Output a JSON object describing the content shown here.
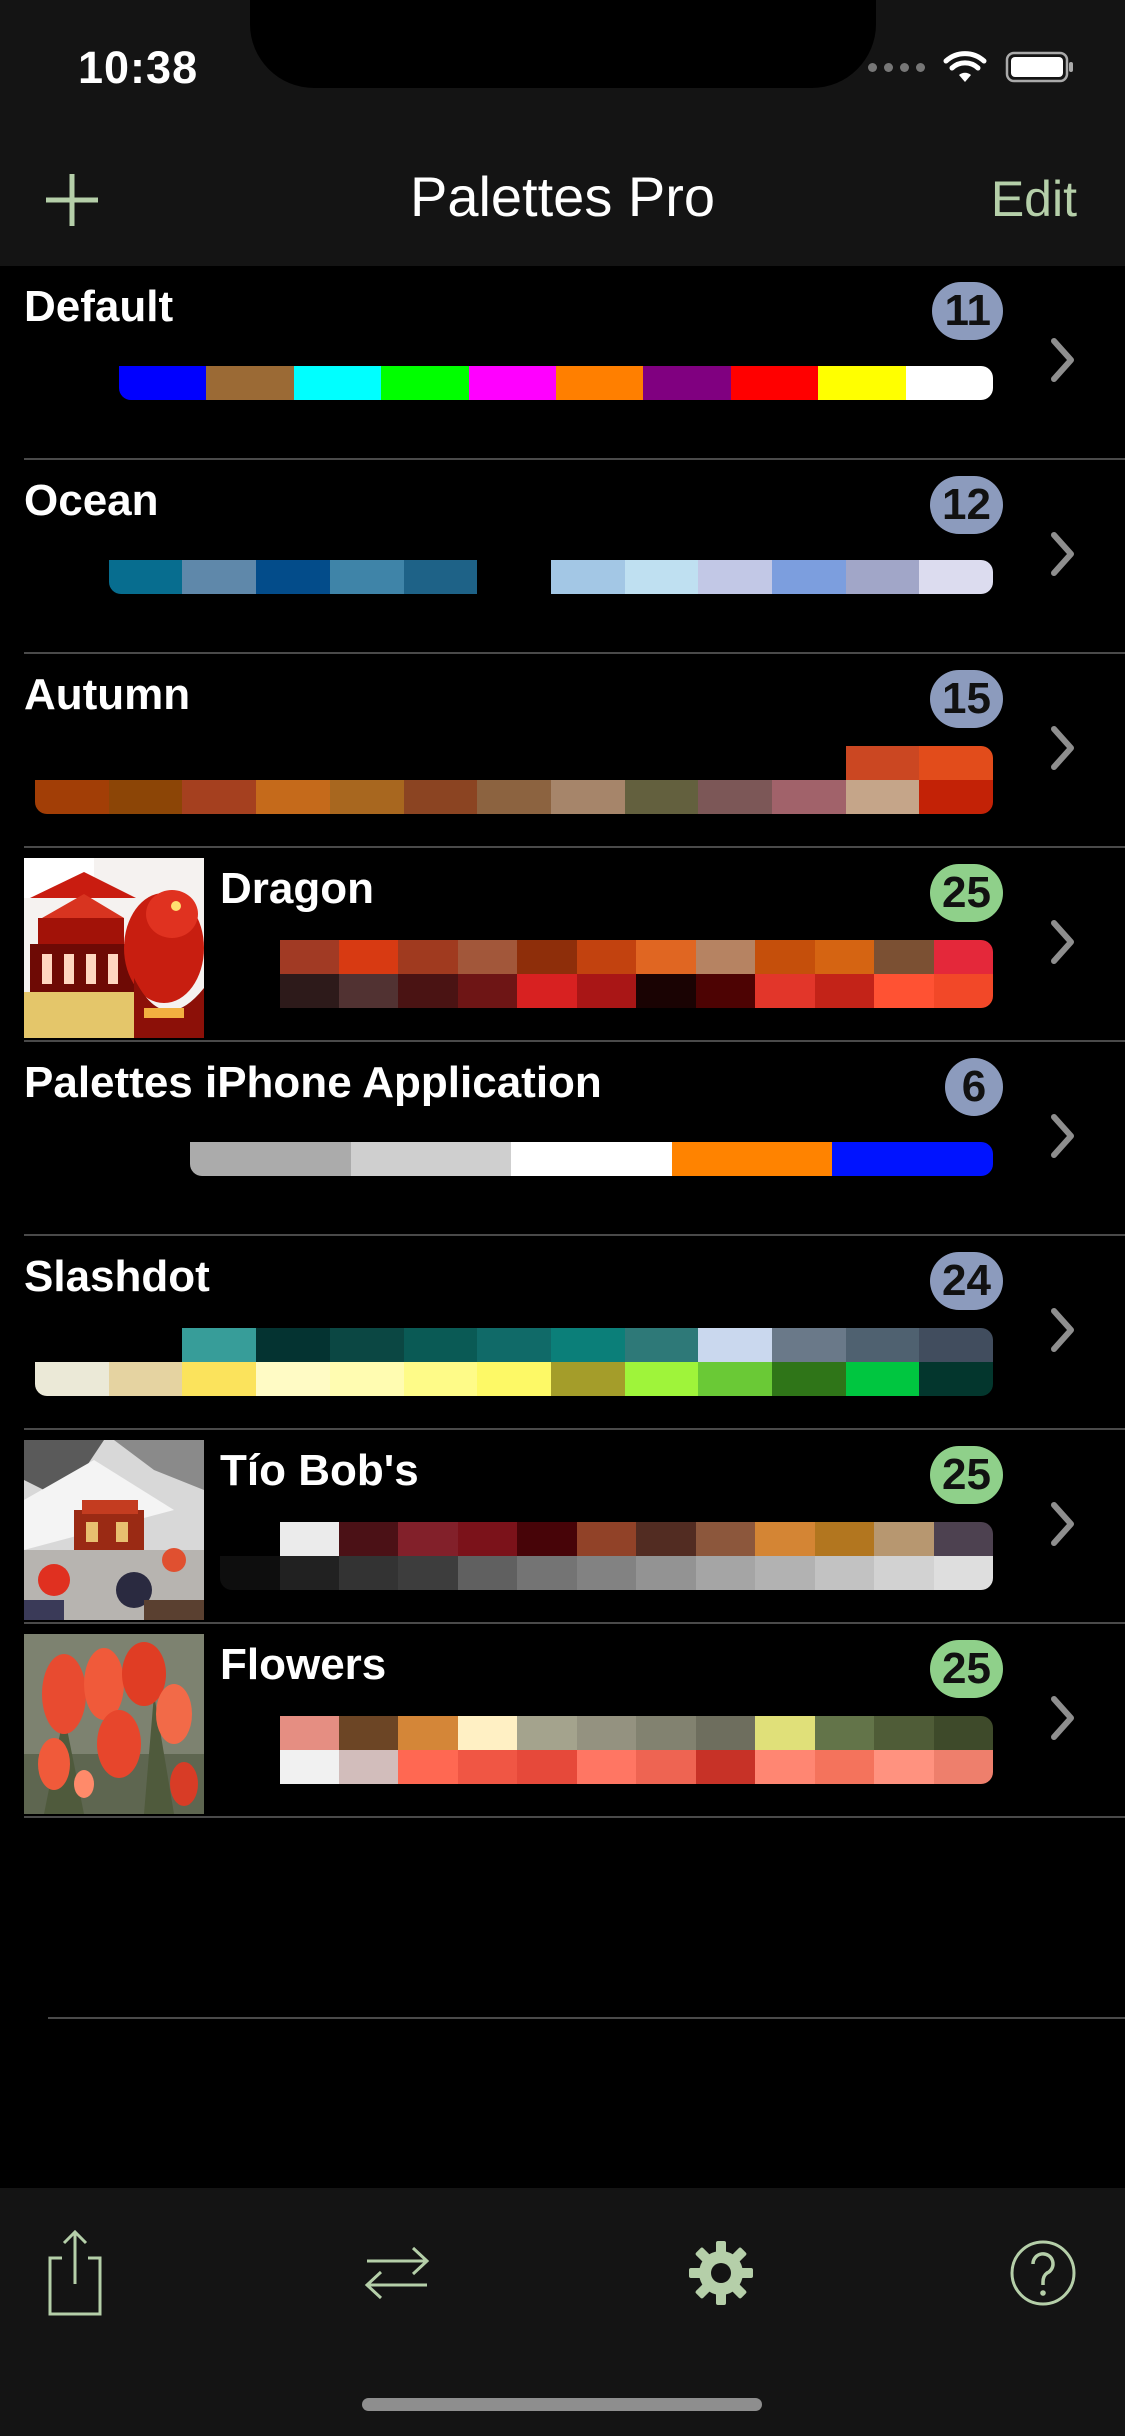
{
  "status": {
    "time": "10:38"
  },
  "nav": {
    "title": "Palettes Pro",
    "edit_label": "Edit"
  },
  "colors": {
    "accent": "#b5cfa9",
    "badge_blue": "#8c9bbd",
    "badge_green": "#8fd08a"
  },
  "palettes": [
    {
      "name": "Default",
      "count": "11",
      "badge_color": "blue",
      "has_thumb": false,
      "colors": [
        "#0000ff",
        "#9b6a35",
        "#00ffff",
        "#00ff00",
        "#ff00ff",
        "#ff7f00",
        "#800080",
        "#ff0000",
        "#ffff00",
        "#ffffff"
      ]
    },
    {
      "name": "Ocean",
      "count": "12",
      "badge_color": "blue",
      "has_thumb": false,
      "colors": [
        "#076d8f",
        "#5f88aa",
        "#034c8a",
        "#3f84a8",
        "#1e6287",
        "#000000",
        "#a3c7e5",
        "#bfe0f1",
        "#c2c8e6",
        "#7c9ede",
        "#a1a6c8",
        "#dcdcef"
      ]
    },
    {
      "name": "Autumn",
      "count": "15",
      "badge_color": "blue",
      "has_thumb": false,
      "colors": [
        "#a23e06",
        "#8c4506",
        "#a5401f",
        "#c56a1b",
        "#a8671f",
        "#8b4422",
        "#8c6340",
        "#a6856a",
        "#63603e",
        "#7c5757",
        "#a1626a",
        "#c5a589",
        "#c32206",
        "#cb4722",
        "#e24c1b"
      ]
    },
    {
      "name": "Dragon",
      "count": "25",
      "badge_color": "green",
      "has_thumb": true,
      "thumb": "dragon-photo",
      "colors": [
        "#000000",
        "#2d1a1a",
        "#513232",
        "#4a1313",
        "#6e1515",
        "#d82121",
        "#a91616",
        "#1a0303",
        "#4d0303",
        "#e2362a",
        "#c32318",
        "#ff5233",
        "#f24828",
        "#a13a24",
        "#d83a12",
        "#a03a1f",
        "#a2573a",
        "#8e2e0a",
        "#c2420f",
        "#e06622",
        "#b68362",
        "#c54f0b",
        "#d56412",
        "#7b5033",
        "#e4283a"
      ]
    },
    {
      "name": "Palettes iPhone Application",
      "count": "6",
      "badge_color": "blue",
      "has_thumb": false,
      "colors": [
        "#ababab",
        "#cfcfcf",
        "#ffffff",
        "#ff8300",
        "#0013ff"
      ]
    },
    {
      "name": "Slashdot",
      "count": "24",
      "badge_color": "blue",
      "has_thumb": false,
      "colors": [
        "#ebe9d7",
        "#e5d3a1",
        "#fbe35c",
        "#fffbc5",
        "#fffcb1",
        "#fefb88",
        "#fdf966",
        "#a49d2a",
        "#9ff43a",
        "#6ac936",
        "#2f7518",
        "#00c640",
        "#03362d",
        "#379d99",
        "#043331",
        "#0b4743",
        "#0a5a55",
        "#106a68",
        "#0b7f79",
        "#2e7978",
        "#cad8ee",
        "#6a7989",
        "#4f6170",
        "#414d5e"
      ]
    },
    {
      "name": "Tío Bob's",
      "count": "25",
      "badge_color": "green",
      "has_thumb": true,
      "thumb": "cafe-photo",
      "colors": [
        "#0e0e0e",
        "#212121",
        "#333333",
        "#3d3d3d",
        "#606060",
        "#747474",
        "#828282",
        "#939393",
        "#a5a5a5",
        "#b2b2b2",
        "#c2c2c2",
        "#d2d2d2",
        "#dedede",
        "#ebebeb",
        "#4b1116",
        "#82202a",
        "#7b121a",
        "#470408",
        "#914228",
        "#522c22",
        "#8c573c",
        "#d48534",
        "#b2761f",
        "#b79770",
        "#4d4150"
      ]
    },
    {
      "name": "Flowers",
      "count": "25",
      "badge_color": "green",
      "has_thumb": true,
      "thumb": "flowers-photo",
      "colors": [
        "#000000",
        "#f1f1f1",
        "#d2bdbb",
        "#ff6852",
        "#f05644",
        "#e6493a",
        "#ff7663",
        "#ee6452",
        "#c73227",
        "#ff8672",
        "#f4735c",
        "#ff927f",
        "#ee7f6c",
        "#e58e82",
        "#6c4525",
        "#d48638",
        "#fff0c4",
        "#a4a38d",
        "#949280",
        "#828270",
        "#6e6e5e",
        "#e0e079",
        "#637449",
        "#4f5c37",
        "#3e4a2a"
      ]
    }
  ],
  "toolbar": {
    "share_icon": "share-icon",
    "swap_icon": "swap-arrows-icon",
    "settings_icon": "gear-icon",
    "help_icon": "help-icon"
  }
}
